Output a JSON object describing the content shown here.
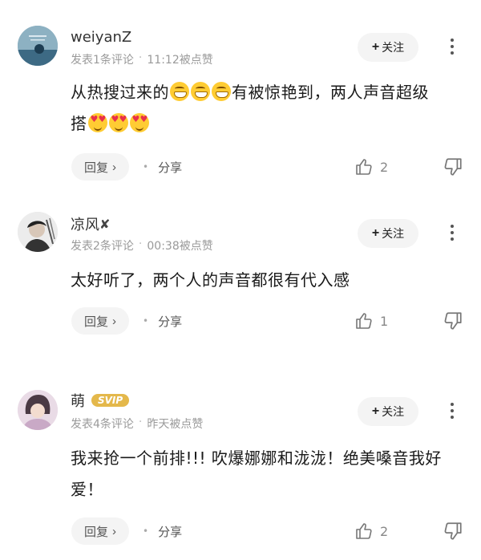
{
  "follow_label": "关注",
  "reply_label": "回复",
  "share_label": "分享",
  "comments": [
    {
      "name": "weiyanZ",
      "meta_count": "发表1条评论",
      "meta_time": "11:12被点赞",
      "text_a": "从热搜过来的",
      "text_b": "有被惊艳到，两人声音超级",
      "text_c": "搭",
      "likes": "2"
    },
    {
      "name": "凉风",
      "verify_mark": "✘",
      "meta_count": "发表2条评论",
      "meta_time": "00:38被点赞",
      "text": "太好听了，两个人的声音都很有代入感",
      "likes": "1"
    },
    {
      "name": "萌",
      "badge": "SVIP",
      "meta_count": "发表4条评论",
      "meta_time": "昨天被点赞",
      "text": "我来抢一个前排!!! 吹爆娜娜和泷泷！绝美嗓音我好爱！",
      "likes": "2"
    }
  ]
}
